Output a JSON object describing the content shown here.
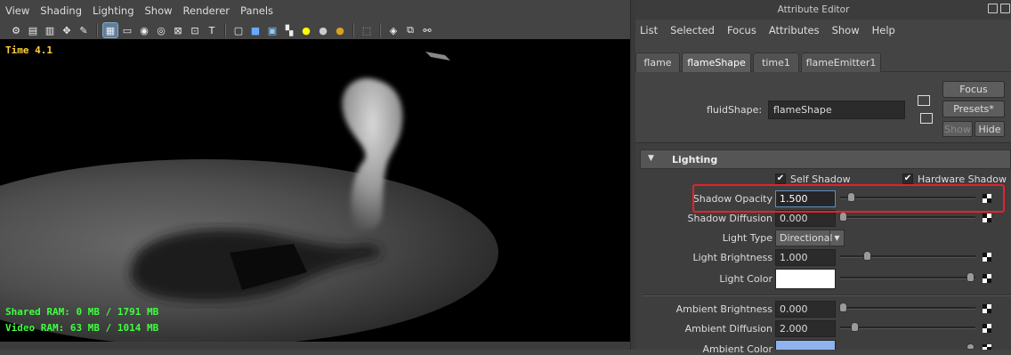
{
  "viewport": {
    "menu": [
      "View",
      "Shading",
      "Lighting",
      "Show",
      "Renderer",
      "Panels"
    ],
    "hud": {
      "time": "Time 4.1",
      "shared_ram": "Shared RAM: 0 MB / 1791 MB",
      "video_ram": "Video RAM: 63 MB / 1014 MB"
    }
  },
  "attribute_editor": {
    "title": "Attribute Editor",
    "menu": [
      "List",
      "Selected",
      "Focus",
      "Attributes",
      "Show",
      "Help"
    ],
    "tabs": [
      "flame",
      "flameShape",
      "time1",
      "flameEmitter1"
    ],
    "active_tab": "flameShape",
    "node_label": "fluidShape:",
    "node_name": "flameShape",
    "buttons": {
      "focus": "Focus",
      "presets": "Presets*",
      "show": "Show",
      "hide": "Hide"
    },
    "section": {
      "title": "Lighting",
      "self_shadow": "Self Shadow",
      "hardware_shadow": "Hardware Shadow",
      "self_shadow_checked": true,
      "hardware_shadow_checked": true,
      "shadow_opacity": {
        "label": "Shadow Opacity",
        "value": "1.500"
      },
      "shadow_diffusion": {
        "label": "Shadow Diffusion",
        "value": "0.000"
      },
      "light_type": {
        "label": "Light Type",
        "value": "Directional"
      },
      "light_brightness": {
        "label": "Light Brightness",
        "value": "1.000"
      },
      "light_color": {
        "label": "Light Color",
        "swatch": "#ffffff"
      },
      "ambient_brightness": {
        "label": "Ambient Brightness",
        "value": "0.000"
      },
      "ambient_diffusion": {
        "label": "Ambient Diffusion",
        "value": "2.000"
      },
      "ambient_color": {
        "label": "Ambient Color",
        "swatch": "#8fb3ee"
      }
    }
  },
  "colors": {
    "highlight": "#e8202a",
    "hud_time": "#ffd23a",
    "hud_ram": "#3eff3e",
    "accent": "#5e8fc0"
  }
}
